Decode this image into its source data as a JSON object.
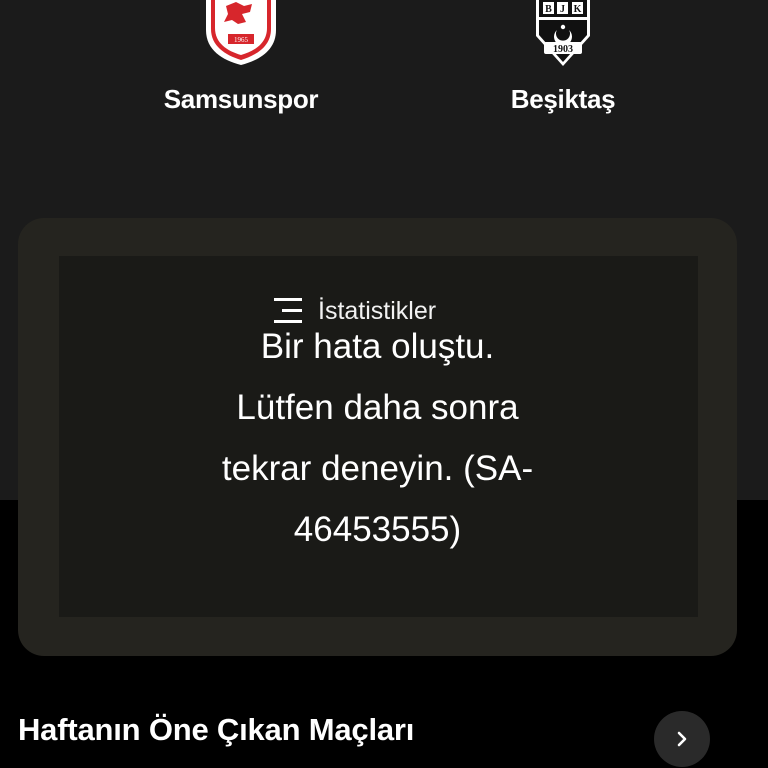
{
  "match": {
    "home_team": {
      "name": "Samsunspor",
      "logo_icon": "samsunspor-logo",
      "logo_year": "1965"
    },
    "away_team": {
      "name": "Beşiktaş",
      "logo_icon": "besiktas-logo",
      "logo_letters": [
        "B",
        "J",
        "K"
      ],
      "logo_year": "1903"
    }
  },
  "stats": {
    "icon": "stats-lines-icon",
    "title": "İstatistikler",
    "error_lines": [
      "Bir hata oluştu.",
      "Lütfen daha sonra",
      "tekrar deneyin. (SA-",
      "46453555)"
    ]
  },
  "featured": {
    "title": "Haftanın Öne Çıkan Maçları",
    "more_icon": "chevron-right-icon"
  },
  "colors": {
    "page_bg": "#000000",
    "panel_bg": "#1b1b1b",
    "card_bg": "#25241f",
    "samsunspor_red": "#d7262c",
    "besiktas_black": "#111111"
  }
}
